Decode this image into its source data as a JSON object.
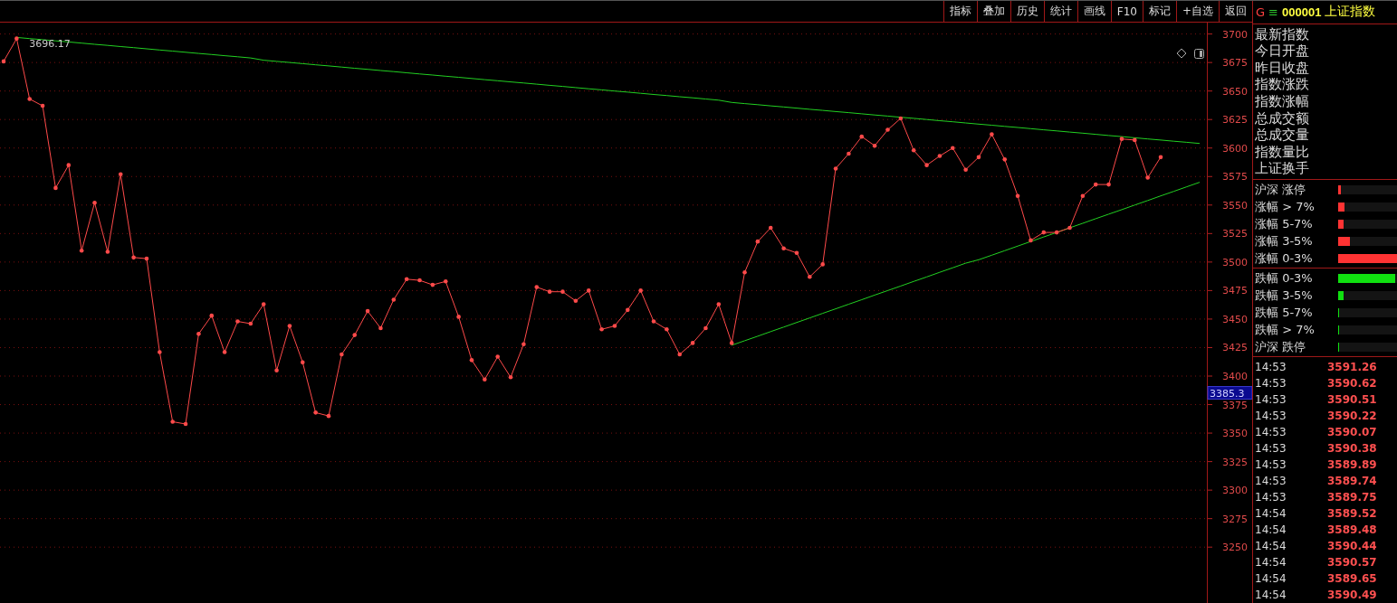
{
  "toolbar": {
    "buttons": [
      "指标",
      "叠加",
      "历史",
      "统计",
      "画线",
      "F10",
      "标记",
      "+自选",
      "返回"
    ]
  },
  "chart": {
    "cursor_value": "3385.3",
    "peak_label": "3696.17",
    "chart_data": {
      "type": "line",
      "grid": true,
      "ylim": [
        3201,
        3710
      ],
      "yticks": [
        3700,
        3675,
        3650,
        3625,
        3600,
        3575,
        3550,
        3525,
        3500,
        3475,
        3450,
        3425,
        3400,
        3375,
        3350,
        3325,
        3300,
        3275,
        3250
      ],
      "series": [
        {
          "color": "#ff4a4a",
          "values": [
            3676,
            3696,
            3643,
            3637,
            3565,
            3585,
            3510,
            3552,
            3509,
            3577,
            3504,
            3503,
            3421,
            3360,
            3358,
            3437,
            3453,
            3421,
            3448,
            3446,
            3463,
            3405,
            3444,
            3412,
            3368,
            3365,
            3419,
            3436,
            3457,
            3442,
            3467,
            3485,
            3484,
            3480,
            3483,
            3452,
            3414,
            3397,
            3417,
            3399,
            3428,
            3478,
            3474,
            3474,
            3466,
            3475,
            3441,
            3444,
            3458,
            3475,
            3448,
            3441,
            3419,
            3429,
            3442,
            3463,
            3429,
            3491,
            3518,
            3530,
            3512,
            3508,
            3487,
            3498,
            3582,
            3595,
            3610,
            3602,
            3616,
            3626,
            3598,
            3585,
            3593,
            3600,
            3581,
            3592,
            3612,
            3590,
            3558,
            3519,
            3526,
            3526,
            3530,
            3558,
            3568,
            3568,
            3608,
            3607,
            3574,
            3592,
            null,
            null,
            null
          ]
        },
        {
          "color": "#22d022",
          "values": [
            null,
            3697,
            3696,
            3695,
            3694,
            3693,
            3692,
            3691,
            3690,
            3689,
            3688,
            3687,
            3686,
            3685,
            3684,
            3683,
            3682,
            3681,
            3680,
            3679,
            3677,
            3676,
            3675,
            3674,
            3673,
            3672,
            3671,
            3670,
            3669,
            3668,
            3667,
            3666,
            3665,
            3664,
            3663,
            3662,
            3661,
            3660,
            3659,
            3658,
            3657,
            3656,
            3655,
            3654,
            3653,
            3652,
            3651,
            3650,
            3649,
            3648,
            3647,
            3646,
            3645,
            3644,
            3643,
            3642,
            3640,
            3639,
            3638,
            3637,
            3636,
            3635,
            3634,
            3633,
            3632,
            3631,
            3630,
            3629,
            3628,
            3627,
            3626,
            3625,
            3624,
            3623,
            3622,
            3621,
            3620,
            3619,
            3618,
            3617,
            3616,
            3615,
            3614,
            3613,
            3612,
            3611,
            3610,
            3609,
            3608,
            3607,
            3606,
            3605,
            3604
          ]
        },
        {
          "color": "#22d022",
          "values": [
            null,
            null,
            null,
            null,
            null,
            null,
            null,
            null,
            null,
            null,
            null,
            null,
            null,
            null,
            null,
            null,
            null,
            null,
            null,
            null,
            null,
            null,
            null,
            null,
            null,
            null,
            null,
            null,
            null,
            null,
            null,
            null,
            null,
            null,
            null,
            null,
            null,
            null,
            null,
            null,
            null,
            null,
            null,
            null,
            null,
            null,
            null,
            null,
            null,
            null,
            null,
            null,
            null,
            null,
            null,
            null,
            3427,
            3431,
            3435,
            3439,
            3443,
            3447,
            3451,
            3455,
            3459,
            3463,
            3467,
            3471,
            3475,
            3479,
            3483,
            3487,
            3491,
            3495,
            3499,
            3502,
            3506,
            3510,
            3514,
            3518,
            3522,
            3526,
            3530,
            3534,
            3538,
            3542,
            3546,
            3550,
            3554,
            3558,
            3562,
            3566,
            3570
          ]
        }
      ]
    }
  },
  "panel": {
    "market_prefix": "G",
    "menu_glyph": "≡",
    "code": "000001",
    "name": "上证指数",
    "quote_labels": [
      "最新指数",
      "今日开盘",
      "昨日收盘",
      "指数涨跌",
      "指数涨幅",
      "总成交额",
      "总成交量",
      "指数量比",
      "上证换手"
    ],
    "advancers": [
      {
        "label": "沪深 涨停",
        "level": 0.05
      },
      {
        "label": "涨幅 > 7%",
        "level": 0.11
      },
      {
        "label": "涨幅 5-7%",
        "level": 0.09
      },
      {
        "label": "涨幅 3-5%",
        "level": 0.2
      },
      {
        "label": "涨幅 0-3%",
        "level": 1
      }
    ],
    "decliners": [
      {
        "label": "跌幅 0-3%",
        "level": 0.97
      },
      {
        "label": "跌幅 3-5%",
        "level": 0.09
      },
      {
        "label": "跌幅 5-7%",
        "level": 0.02
      },
      {
        "label": "跌幅 > 7%",
        "level": 0.02
      },
      {
        "label": "沪深 跌停",
        "level": 0.02
      }
    ],
    "ticks": [
      {
        "time": "14:53",
        "price": "3591.26"
      },
      {
        "time": "14:53",
        "price": "3590.62"
      },
      {
        "time": "14:53",
        "price": "3590.51"
      },
      {
        "time": "14:53",
        "price": "3590.22"
      },
      {
        "time": "14:53",
        "price": "3590.07"
      },
      {
        "time": "14:53",
        "price": "3590.38"
      },
      {
        "time": "14:53",
        "price": "3589.89"
      },
      {
        "time": "14:53",
        "price": "3589.74"
      },
      {
        "time": "14:53",
        "price": "3589.75"
      },
      {
        "time": "14:54",
        "price": "3589.52"
      },
      {
        "time": "14:54",
        "price": "3589.48"
      },
      {
        "time": "14:54",
        "price": "3590.44"
      },
      {
        "time": "14:54",
        "price": "3590.57"
      },
      {
        "time": "14:54",
        "price": "3589.65"
      },
      {
        "time": "14:54",
        "price": "3590.49"
      }
    ]
  }
}
